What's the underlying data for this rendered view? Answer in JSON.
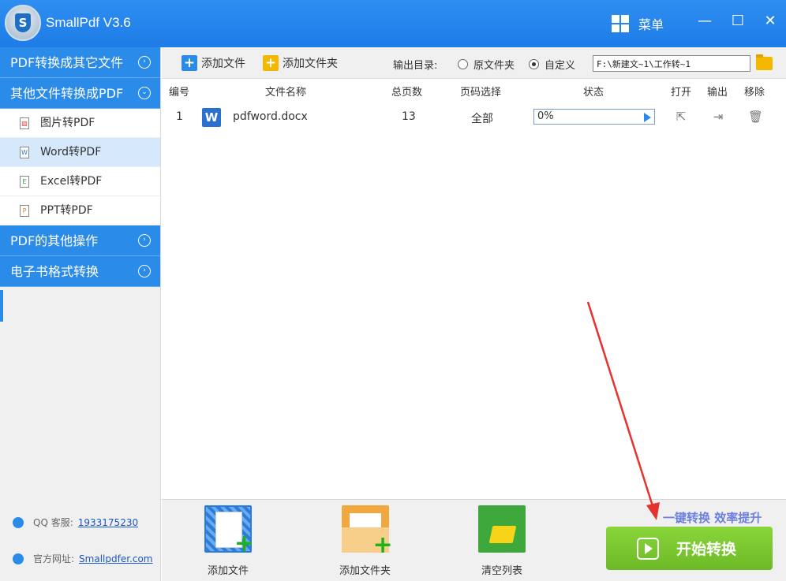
{
  "app": {
    "title": "SmallPdf V3.6",
    "menu_label": "菜单",
    "logo_letter": "S"
  },
  "window": {
    "minimize": "—",
    "maximize": "☐",
    "close": "✕"
  },
  "sidebar": {
    "categories": [
      {
        "label": "PDF转换成其它文件",
        "expanded": false
      },
      {
        "label": "其他文件转换成PDF",
        "expanded": true
      },
      {
        "label": "PDF的其他操作",
        "expanded": false
      },
      {
        "label": "电子书格式转换",
        "expanded": false
      }
    ],
    "subitems": [
      {
        "label": "图片转PDF",
        "icon": "image-file-icon",
        "glyph": "▨"
      },
      {
        "label": "Word转PDF",
        "icon": "word-file-icon",
        "glyph": "W",
        "active": true
      },
      {
        "label": "Excel转PDF",
        "icon": "excel-file-icon",
        "glyph": "E"
      },
      {
        "label": "PPT转PDF",
        "icon": "ppt-file-icon",
        "glyph": "P"
      }
    ],
    "contact": {
      "qq_label": "QQ 客服:",
      "qq_number": "1933175230",
      "site_label": "官方网址:",
      "site_link": "Smallpdfer.com"
    }
  },
  "toolbar": {
    "add_file": "添加文件",
    "add_folder": "添加文件夹",
    "output_label": "输出目录:",
    "radio_original": "原文件夹",
    "radio_custom": "自定义",
    "selected_radio": "自定义",
    "output_path": "F:\\新建文~1\\工作转~1"
  },
  "table": {
    "headers": [
      "编号",
      "文件名称",
      "总页数",
      "页码选择",
      "状态",
      "打开",
      "输出",
      "移除"
    ],
    "rows": [
      {
        "index": "1",
        "file_icon": "W",
        "name": "pdfword.docx",
        "pages": "13",
        "page_select": "全部",
        "status": "0%"
      }
    ]
  },
  "bottom": {
    "add_file": "添加文件",
    "add_folder": "添加文件夹",
    "clear_list": "清空列表",
    "promo": "一键转换  效率提升",
    "start": "开始转换"
  },
  "colors": {
    "accent": "#2b8be8",
    "start_green": "#78c532",
    "annotation_red": "#e5322d"
  }
}
